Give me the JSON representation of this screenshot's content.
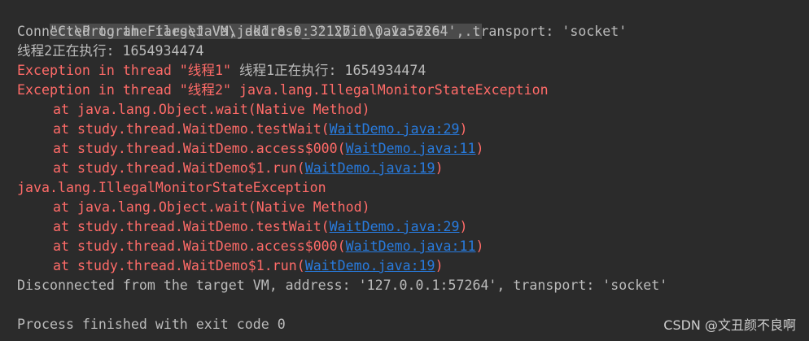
{
  "console": {
    "command": "\"C:\\Program Files\\Java\\jdk1.8.0_321\\bin\\java.exe\" ...",
    "connected": "Connected to the target VM, address: '127.0.0.1:57264', transport: 'socket'",
    "line_thread2_running": "线程2正在执行: 1654934474",
    "exc1_prefix": "Exception in thread \"线程1\" ",
    "exc1_suffix": "线程1正在执行: 1654934474",
    "exc2": "Exception in thread \"线程2\" java.lang.IllegalMonitorStateException",
    "trace1": {
      "frame1": "at java.lang.Object.wait(Native Method)",
      "frame2_prefix": "at study.thread.WaitDemo.testWait(",
      "frame2_link": "WaitDemo.java:29",
      "frame3_prefix": "at study.thread.WaitDemo.access$000(",
      "frame3_link": "WaitDemo.java:11",
      "frame4_prefix": "at study.thread.WaitDemo$1.run(",
      "frame4_link": "WaitDemo.java:19",
      "close": ")"
    },
    "exc3": "java.lang.IllegalMonitorStateException",
    "trace2": {
      "frame1": "at java.lang.Object.wait(Native Method)",
      "frame2_prefix": "at study.thread.WaitDemo.testWait(",
      "frame2_link": "WaitDemo.java:29",
      "frame3_prefix": "at study.thread.WaitDemo.access$000(",
      "frame3_link": "WaitDemo.java:11",
      "frame4_prefix": "at study.thread.WaitDemo$1.run(",
      "frame4_link": "WaitDemo.java:19",
      "close": ")"
    },
    "disconnected": "Disconnected from the target VM, address: '127.0.0.1:57264', transport: 'socket'",
    "finished": "Process finished with exit code 0"
  },
  "watermark": "CSDN @文丑颜不良啊",
  "colors": {
    "background": "#2b2b2b",
    "error_text": "#ff6b68",
    "normal_text": "#bbbbbb",
    "link": "#287bde",
    "command_highlight": "#4b4b4b"
  }
}
